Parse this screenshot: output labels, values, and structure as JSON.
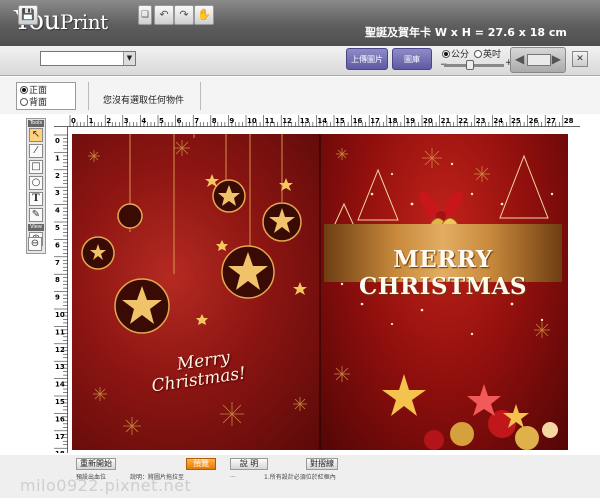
{
  "header": {
    "logo_main": "You",
    "logo_small": "Print",
    "product_title": "聖誕及賀年卡  W x H = 27.6 x 18 cm"
  },
  "toolbar": {
    "upload_label": "上傳圖片",
    "gallery_label": "圖庫",
    "unit_cm": "公分",
    "unit_inch": "英吋",
    "selected_unit": "cm"
  },
  "side_panel": {
    "front_label": "正面",
    "back_label": "背面",
    "selected_face": "front",
    "no_selection": "您沒有選取任何物件"
  },
  "tools": {
    "tools_header": "Tools",
    "view_header": "View"
  },
  "rulers": {
    "top_ticks": [
      "0",
      "1",
      "2",
      "3",
      "4",
      "5",
      "6",
      "7",
      "8",
      "9",
      "10",
      "11",
      "12",
      "13",
      "14",
      "15",
      "16",
      "17",
      "18",
      "19",
      "20",
      "21",
      "22",
      "23",
      "24",
      "25",
      "26",
      "27",
      "28"
    ],
    "left_ticks": [
      "0",
      "1",
      "2",
      "3",
      "4",
      "5",
      "6",
      "7",
      "8",
      "9",
      "10",
      "11",
      "12",
      "13",
      "14",
      "15",
      "16",
      "17",
      "18"
    ]
  },
  "card": {
    "banner_text": "MERRY CHRISTMAS",
    "script_line1": "Merry",
    "script_line2": "Christmas!"
  },
  "bottom": {
    "btn1": "重新開始",
    "btn2": "說 明",
    "btn3": "預覽",
    "btn4": "對摺線",
    "note1": "預設出血位",
    "note2": "說明：將圖片拖拉至",
    "note3": "...",
    "note4": "1.所有設計必須位於紅框內",
    "watermark": "milo0922.pixnet.net"
  },
  "colors": {
    "header_bg": "#5e5e5e",
    "accent_purple": "#5d59a3",
    "card_red": "#8f0f0d",
    "banner_gold": "#e2ad62"
  }
}
